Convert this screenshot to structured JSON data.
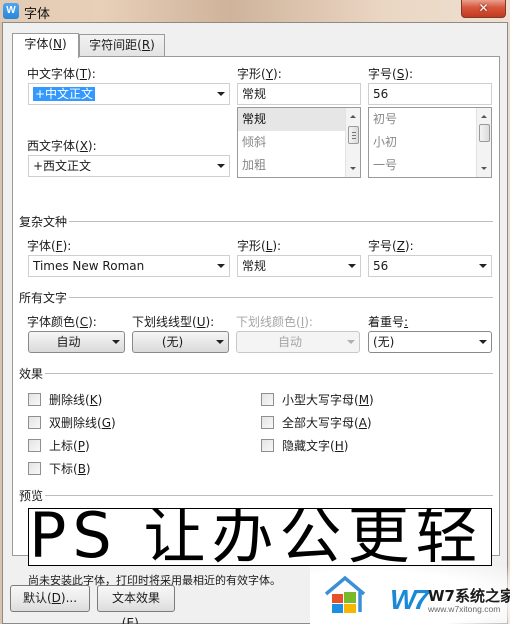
{
  "window": {
    "title": "字体",
    "app_icon_glyph": "W",
    "close_glyph": "✕"
  },
  "tabs": [
    {
      "label": "字体(",
      "key": "N",
      "suffix": ")",
      "active": true
    },
    {
      "label": "字符间距(",
      "key": "R",
      "suffix": ")",
      "active": false
    }
  ],
  "font_fields": {
    "chinese_font": {
      "label": "中文字体(",
      "key": "T",
      "suffix": "):",
      "value": "+中文正文"
    },
    "western_font": {
      "label": "西文字体(",
      "key": "X",
      "suffix": "):",
      "value": "+西文正文"
    },
    "style": {
      "label": "字形(",
      "key": "Y",
      "suffix": "):",
      "value": "常规",
      "options": [
        "常规",
        "倾斜",
        "加粗"
      ],
      "selected_index": 0
    },
    "size": {
      "label": "字号(",
      "key": "S",
      "suffix": "):",
      "value": "56",
      "options": [
        "初号",
        "小初",
        "一号"
      ]
    }
  },
  "complex_script": {
    "section_title": "复杂文种",
    "font": {
      "label": "字体(",
      "key": "F",
      "suffix": "):",
      "value": "Times New Roman"
    },
    "style": {
      "label": "字形(",
      "key": "L",
      "suffix": "):",
      "value": "常规"
    },
    "size": {
      "label": "字号(",
      "key": "Z",
      "suffix": "):",
      "value": "56"
    }
  },
  "all_text": {
    "section_title": "所有文字",
    "font_color": {
      "label": "字体颜色(",
      "key": "C",
      "suffix": "):",
      "value": "自动"
    },
    "underline_style": {
      "label": "下划线线型(",
      "key": "U",
      "suffix": "):",
      "value": "(无)"
    },
    "underline_color": {
      "label": "下划线颜色(",
      "key": "I",
      "suffix": "):",
      "value": "自动",
      "disabled": true
    },
    "emphasis_mark": {
      "label": "着重号",
      "key": ":",
      "value": "(无)"
    }
  },
  "effects": {
    "section_title": "效果",
    "items": [
      {
        "label": "删除线(",
        "key": "K",
        "suffix": ")",
        "checked": false
      },
      {
        "label": "双删除线(",
        "key": "G",
        "suffix": ")",
        "checked": false
      },
      {
        "label": "上标(",
        "key": "P",
        "suffix": ")",
        "checked": false
      },
      {
        "label": "下标(",
        "key": "B",
        "suffix": ")",
        "checked": false
      },
      {
        "label": "小型大写字母(",
        "key": "M",
        "suffix": ")",
        "checked": false
      },
      {
        "label": "全部大写字母(",
        "key": "A",
        "suffix": ")",
        "checked": false
      },
      {
        "label": "隐藏文字(",
        "key": "H",
        "suffix": ")",
        "checked": false
      }
    ]
  },
  "preview": {
    "section_title": "预览",
    "sample_text": "PS 让办公更轻",
    "note": "尚未安装此字体，打印时将采用最相近的有效字体。"
  },
  "buttons": {
    "default": {
      "label": "默认(",
      "key": "D",
      "suffix": ")..."
    },
    "text_effects": {
      "label": "文本效果(",
      "key": "E",
      "suffix": ")..."
    }
  },
  "watermark": {
    "logo": "W7",
    "name": "W7系统之家",
    "url": "www.w7xitong.com"
  }
}
